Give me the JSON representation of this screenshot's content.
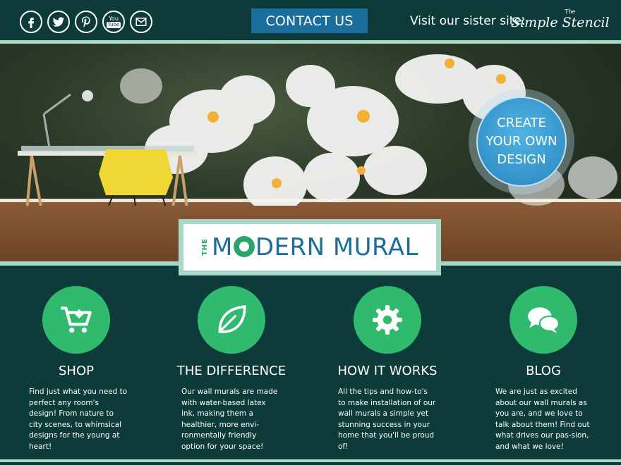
{
  "topbar": {
    "social": [
      {
        "name": "facebook-icon",
        "glyph": "f"
      },
      {
        "name": "twitter-icon",
        "glyph": "t"
      },
      {
        "name": "pinterest-icon",
        "glyph": "p"
      },
      {
        "name": "youtube-icon",
        "text_top": "You",
        "text_bottom": "Tube"
      },
      {
        "name": "email-icon",
        "glyph": "mail"
      }
    ],
    "contact_label": "CONTACT US",
    "sister_label": "Visit our sister site:",
    "sister_logo_small": "The",
    "sister_logo_main": "Simple Stencil"
  },
  "hero": {
    "cta_label": "CREATE YOUR OWN DESIGN"
  },
  "logo": {
    "the": "THE",
    "m": "M",
    "rest": "DERN MURAL"
  },
  "features": [
    {
      "icon": "shopping-cart-icon",
      "title": "SHOP",
      "body": "Find just what you need to perfect any room's design! From nature to city scenes, to whimsical designs for the young at heart!"
    },
    {
      "icon": "leaf-icon",
      "title": "THE DIFFERENCE",
      "body": "Our wall murals are made with water-based latex ink, making them a healthier, more envi-ronmentally friendly option for your space!"
    },
    {
      "icon": "gear-icon",
      "title": "HOW IT WORKS",
      "body": "All the tips and how-to's to make installation of our wall murals a simple yet stunning success in your home that you'll be proud of!"
    },
    {
      "icon": "chat-bubbles-icon",
      "title": "BLOG",
      "body": "We are just as excited about our wall murals as you are, and we love to talk about them! Find out what drives our pas-sion, and what we love!"
    }
  ],
  "colors": {
    "background": "#0d3b3a",
    "accent_mint": "#a9d8c8",
    "contact_blue": "#1a6e9c",
    "feature_green": "#2fba6e",
    "cta_blue": "#3a9fd6"
  }
}
